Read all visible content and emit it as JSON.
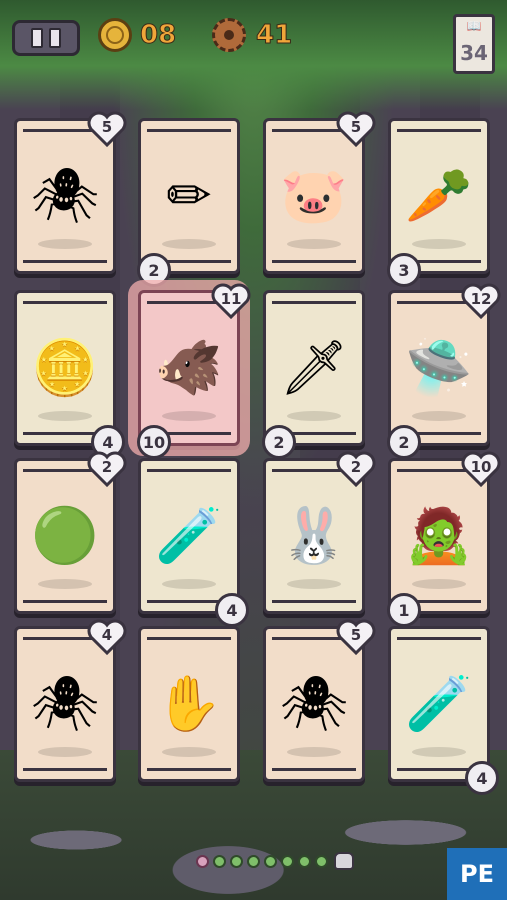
{
  "hud": {
    "coins": "08",
    "gears": "41",
    "deck_count": "34"
  },
  "cards": [
    {
      "id": "spider-1",
      "art": "🕷",
      "heart": "5",
      "badge": "",
      "badge_side": ""
    },
    {
      "id": "pencils",
      "art": "✏",
      "heart": "",
      "badge": "2",
      "badge_side": "bl"
    },
    {
      "id": "pig-smith",
      "art": "🐷",
      "heart": "5",
      "badge": "",
      "badge_side": ""
    },
    {
      "id": "carrot",
      "art": "🥕",
      "heart": "",
      "badge": "3",
      "badge_side": "bl"
    },
    {
      "id": "coin",
      "art": "🪙",
      "heart": "",
      "badge": "4",
      "badge_side": "br"
    },
    {
      "id": "hero-pig",
      "art": "🐗",
      "heart": "11",
      "badge": "10",
      "badge_side": "bl"
    },
    {
      "id": "sword",
      "art": "🗡",
      "heart": "",
      "badge": "2",
      "badge_side": "bl"
    },
    {
      "id": "ufo",
      "art": "🛸",
      "heart": "12",
      "badge": "2",
      "badge_side": "bl"
    },
    {
      "id": "slime",
      "art": "🟢",
      "heart": "2",
      "badge": "",
      "badge_side": ""
    },
    {
      "id": "potion-1",
      "art": "🧪",
      "heart": "",
      "badge": "4",
      "badge_side": "br"
    },
    {
      "id": "bunny",
      "art": "🐰",
      "heart": "2",
      "badge": "",
      "badge_side": ""
    },
    {
      "id": "zombie",
      "art": "🧟",
      "heart": "10",
      "badge": "1",
      "badge_side": "bl"
    },
    {
      "id": "spider-2",
      "art": "🕷",
      "heart": "4",
      "badge": "",
      "badge_side": ""
    },
    {
      "id": "zombie-hand",
      "art": "✋",
      "heart": "",
      "badge": "",
      "badge_side": ""
    },
    {
      "id": "spider-3",
      "art": "🕷",
      "heart": "5",
      "badge": "",
      "badge_side": ""
    },
    {
      "id": "potion-2",
      "art": "🧪",
      "heart": "",
      "badge": "4",
      "badge_side": "br"
    }
  ],
  "footer": {
    "pe_label": "PE"
  }
}
